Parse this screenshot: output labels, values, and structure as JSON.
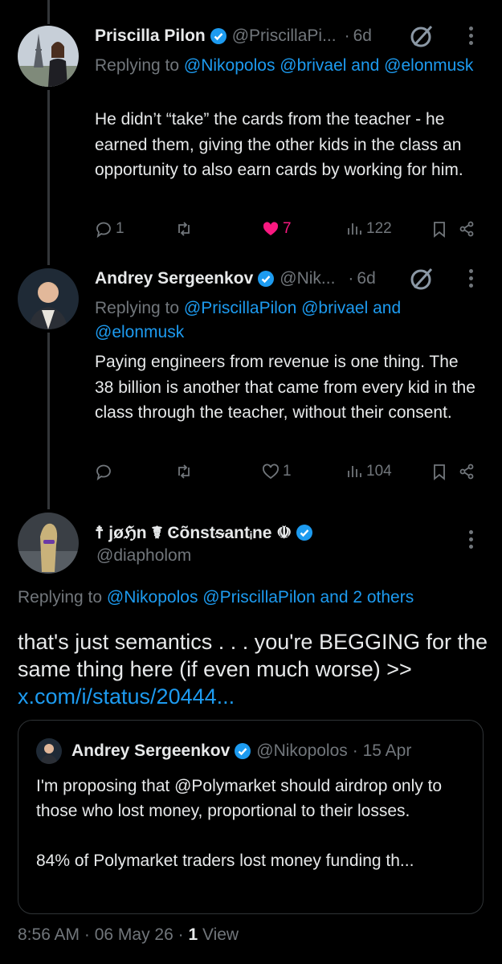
{
  "replies": [
    {
      "name": "Priscilla Pilon",
      "handle": "@PriscillaPi...",
      "time": "6d",
      "replying_prefix": "Replying to",
      "replying_links": "@Nikopolos @brivael and @elonmusk",
      "text": "He didn’t “take” the cards from the teacher - he earned them, giving the other kids in the class an opportunity to also earn cards by working for him.",
      "reply_count": "1",
      "repost_count": "",
      "like_count": "7",
      "view_count": "122"
    },
    {
      "name": "Andrey Sergeenkov",
      "handle": "@Nik...",
      "time": "6d",
      "replying_prefix": "Replying to",
      "replying_links": "@PriscillaPilon @brivael and @elonmusk",
      "text": "Paying engineers from revenue is one thing. The 38 billion is another that came from every kid in the class through the teacher, without their consent.",
      "reply_count": "",
      "repost_count": "",
      "like_count": "1",
      "view_count": "104"
    }
  ],
  "main_post": {
    "name": "☨ jøℌn ☤ Ͼõnstᵴantᵢne ☫",
    "handle": "@diapholom",
    "replying_prefix": "Replying to",
    "replying_links": "@Nikopolos @PriscillaPilon and 2 others",
    "text": "that's just semantics . . . you're BEGGING for the same thing here (if even much worse) >>",
    "link": "x.com/i/status/20444...",
    "quote": {
      "name": "Andrey Sergeenkov",
      "handle": "@Nikopolos",
      "time": "· 15 Apr",
      "para1": "I'm proposing that @Polymarket should airdrop only to those who lost money, proportional to their losses.",
      "para2": "84% of Polymarket traders lost money funding th..."
    },
    "timestamp": "8:56 AM · 06 May 26 · ",
    "views_count": "1",
    "views_label": " View"
  },
  "colors": {
    "accent": "#1d9bf0",
    "like": "#f91880",
    "muted": "#71767b",
    "text": "#e7e9ea"
  }
}
